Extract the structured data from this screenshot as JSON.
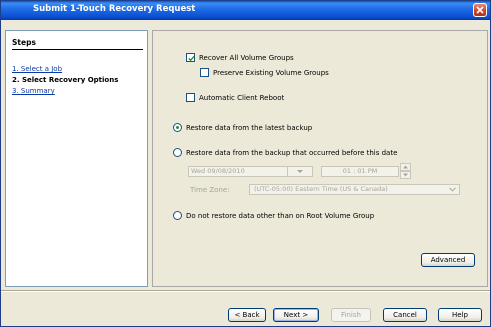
{
  "window": {
    "title": "Submit 1-Touch Recovery Request"
  },
  "steps": {
    "heading": "Steps",
    "items": [
      {
        "label": "1. Select a Job"
      },
      {
        "label": "2. Select Recovery Options"
      },
      {
        "label": "3. Summary"
      }
    ]
  },
  "options": {
    "recover_all_volume_groups": {
      "label": "Recover All Volume Groups",
      "checked": true
    },
    "preserve_existing_volume_groups": {
      "label": "Preserve Existing Volume Groups",
      "checked": false
    },
    "automatic_client_reboot": {
      "label": "Automatic Client Reboot",
      "checked": false
    },
    "restore_latest": {
      "label": "Restore data from the latest backup",
      "selected": true
    },
    "restore_before_date": {
      "label": "Restore data from the backup that occurred before this date",
      "selected": false,
      "date_value": "Wed 09/08/2010",
      "time_value": "01 : 01 PM",
      "time_zone_label": "Time Zone:",
      "time_zone_value": "(UTC-05:00) Eastern Time (US & Canada)"
    },
    "root_volume_only": {
      "label": "Do not restore data other than on Root Volume Group",
      "selected": false
    }
  },
  "buttons": {
    "advanced": "Advanced",
    "back": "< Back",
    "next": "Next >",
    "finish": "Finish",
    "cancel": "Cancel",
    "help": "Help"
  },
  "colors": {
    "title_bar": "#1d69e6",
    "link": "#0b3aa8",
    "check_mark": "#2a8f2a",
    "disabled_text": "#a7a59a"
  },
  "icons": [
    "close-icon",
    "check-icon",
    "dropdown-arrow-icon",
    "spinner-up-icon",
    "spinner-down-icon"
  ]
}
